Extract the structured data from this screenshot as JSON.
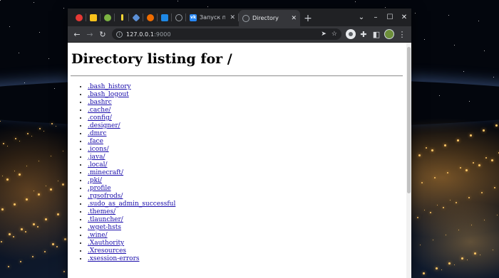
{
  "tabs": [
    {
      "icon": "red-circle-icon",
      "color": "#e53935"
    },
    {
      "icon": "yellow-square-icon",
      "color": "#f9c21b"
    },
    {
      "icon": "green-round-icon",
      "color": "#7cb342"
    },
    {
      "icon": "flashlight-icon",
      "color": "#fdd835"
    },
    {
      "icon": "heart-icon",
      "color": "#5b8fd6"
    },
    {
      "icon": "orange-fruit-icon",
      "color": "#ef6c00"
    },
    {
      "icon": "app-icon",
      "color": "#1e88e5"
    },
    {
      "icon": "globe-icon",
      "color": "#9aa0a6"
    }
  ],
  "tab_vk": {
    "title": "Запуск п",
    "close": "✕"
  },
  "tab_active": {
    "title": "Directory",
    "close": "✕"
  },
  "new_tab": "+",
  "window_controls": {
    "dropdown": "⌄",
    "minimize": "–",
    "maximize": "☐",
    "close": "✕"
  },
  "toolbar": {
    "back": "←",
    "forward": "→",
    "reload": "↻",
    "url_host": "127.0.0.1",
    "url_port": ":9000",
    "send": "➤",
    "bookmark": "☆",
    "extensions": "✚",
    "sidebar": "◧",
    "menu": "⋮"
  },
  "page": {
    "title": "Directory listing for /",
    "entries": [
      ".bash_history",
      ".bash_logout",
      ".bashrc",
      ".cache/",
      ".config/",
      ".designer/",
      ".dmrc",
      ".face",
      ".icons/",
      ".java/",
      ".local/",
      ".minecraft/",
      ".pki/",
      ".profile",
      ".rgsofrods/",
      ".sudo_as_admin_successful",
      ".themes/",
      ".tlauncher/",
      ".wget-hsts",
      ".wine/",
      ".Xauthority",
      ".Xresources",
      ".xsession-errors"
    ]
  }
}
